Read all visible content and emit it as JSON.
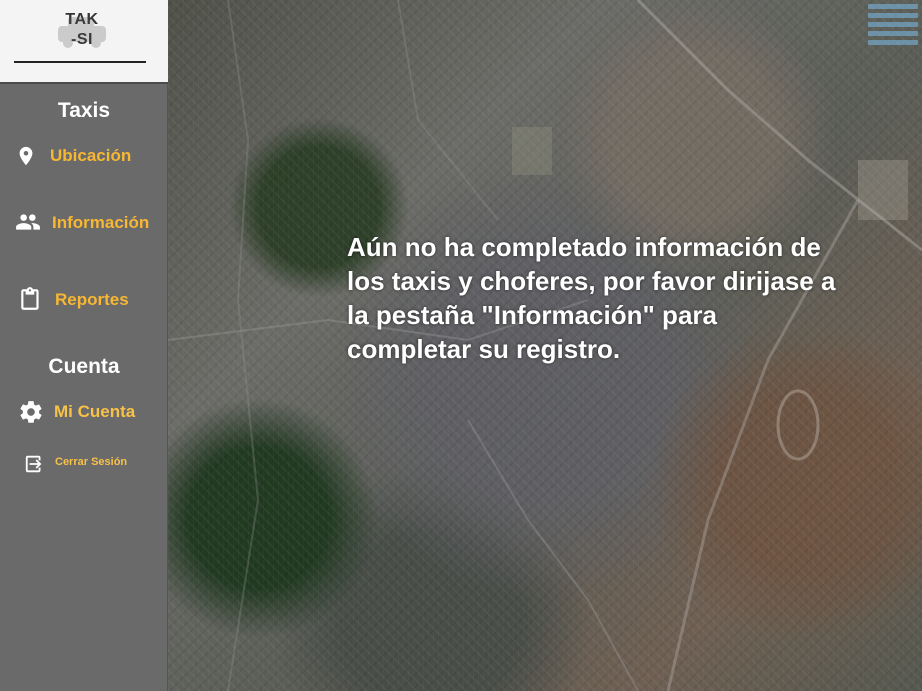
{
  "brand": {
    "logo_line1": "TAK",
    "logo_line2": "-SI"
  },
  "sidebar": {
    "section_taxis": "Taxis",
    "section_account": "Cuenta",
    "items": [
      {
        "label": "Ubicación",
        "icon": "location-pin-icon"
      },
      {
        "label": "Información",
        "icon": "people-icon"
      },
      {
        "label": "Reportes",
        "icon": "clipboard-icon"
      },
      {
        "label": "Mi Cuenta",
        "icon": "gear-icon"
      },
      {
        "label": "Cerrar Sesión",
        "icon": "logout-icon"
      }
    ]
  },
  "main": {
    "message": "Aún no ha completado información de los taxis y choferes, por favor dirijase a la pestaña \"Información\" para completar su registro."
  },
  "colors": {
    "sidebar_bg": "#6a6a6a",
    "accent": "#f7b733",
    "text_white": "#ffffff"
  }
}
